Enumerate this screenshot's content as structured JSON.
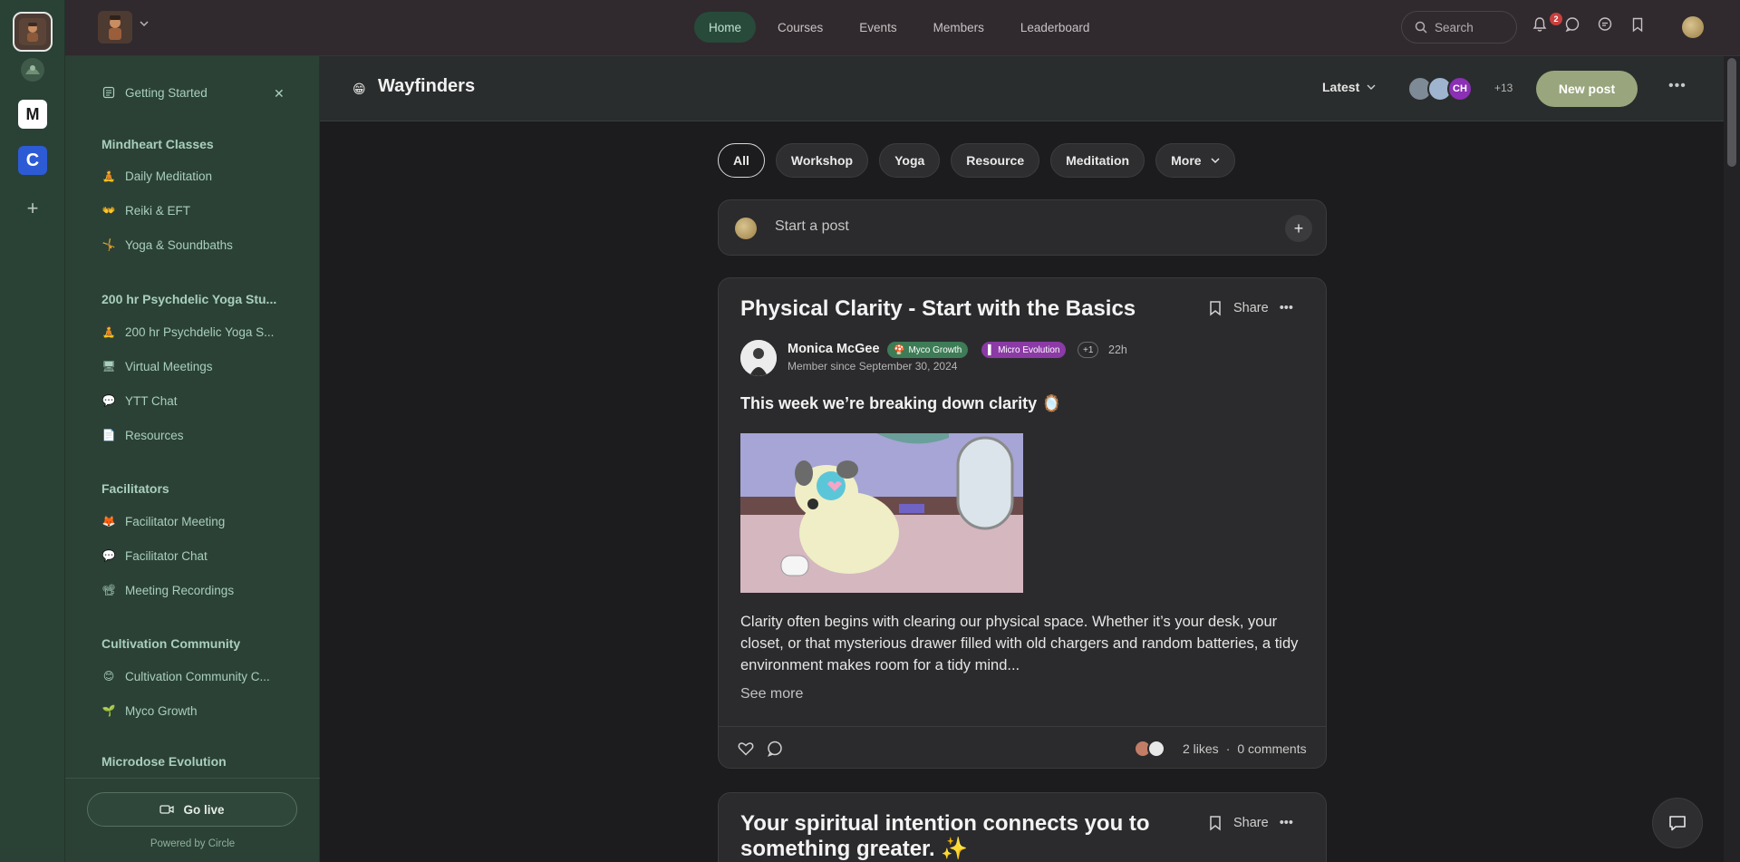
{
  "rail": {
    "communities": [
      {
        "name": "community-active",
        "letter": ""
      },
      {
        "name": "community-2",
        "letter": ""
      },
      {
        "name": "community-m",
        "letter": "M"
      },
      {
        "name": "community-c",
        "letter": "C"
      }
    ]
  },
  "header": {
    "tabs": [
      {
        "label": "Home",
        "active": true
      },
      {
        "label": "Courses",
        "active": false
      },
      {
        "label": "Events",
        "active": false
      },
      {
        "label": "Members",
        "active": false
      },
      {
        "label": "Leaderboard",
        "active": false
      }
    ],
    "search_label": "Search",
    "notification_count": "2"
  },
  "sidebar": {
    "getting_started": "Getting Started",
    "sections": [
      {
        "heading": "Mindheart Classes",
        "items": [
          {
            "label": "Daily Meditation",
            "icon": "🧘"
          },
          {
            "label": "Reiki & EFT",
            "icon": "👐"
          },
          {
            "label": "Yoga & Soundbaths",
            "icon": "🤸"
          }
        ]
      },
      {
        "heading": "200 hr Psychdelic Yoga Stu...",
        "items": [
          {
            "label": "200 hr Psychdelic Yoga S...",
            "icon": "🧘"
          },
          {
            "label": "Virtual Meetings",
            "icon": "🖥"
          },
          {
            "label": "YTT Chat",
            "icon": "💬"
          },
          {
            "label": "Resources",
            "icon": "📄"
          }
        ]
      },
      {
        "heading": "Facilitators",
        "items": [
          {
            "label": "Facilitator Meeting",
            "icon": "🦊"
          },
          {
            "label": "Facilitator Chat",
            "icon": "💬"
          },
          {
            "label": "Meeting Recordings",
            "icon": "📽"
          }
        ]
      },
      {
        "heading": "Cultivation Community",
        "items": [
          {
            "label": "Cultivation Community C...",
            "icon": "😊"
          },
          {
            "label": "Myco Growth",
            "icon": "🌱"
          }
        ]
      },
      {
        "heading": "Microdose Evolution",
        "items": []
      }
    ],
    "go_live": "Go live",
    "powered_by": "Powered by Circle"
  },
  "space": {
    "emoji": "😁",
    "title": "Wayfinders",
    "sort": "Latest",
    "member_initials": "CH",
    "member_more": "+13",
    "new_post": "New post"
  },
  "filters": [
    "All",
    "Workshop",
    "Yoga",
    "Resource",
    "Meditation",
    "More"
  ],
  "composer": {
    "placeholder": "Start a post"
  },
  "posts": [
    {
      "title": "Physical Clarity - Start with the Basics",
      "share": "Share",
      "author": "Monica McGee",
      "badges": [
        "Myco Growth",
        "Micro Evolution",
        "+1"
      ],
      "time": "22h",
      "member_since": "Member since September 30, 2024",
      "lead": "This week we’re breaking down clarity 🪞",
      "body": "Clarity often begins with clearing our physical space. Whether it’s your desk, your closet, or that mysterious drawer filled with old chargers and random batteries, a tidy environment makes room for a tidy mind...",
      "see_more": "See more",
      "likes": "2 likes",
      "separator": "·",
      "comments": "0 comments"
    },
    {
      "title": "Your spiritual intention connects you to something greater. ✨",
      "share": "Share"
    }
  ],
  "colors": {
    "accent": "#284a3b",
    "sidebar_bg": "#2b4135",
    "new_post_btn": "#99a67d",
    "badge_myco": "#3d7c56",
    "badge_micro": "#8b3aa6"
  }
}
